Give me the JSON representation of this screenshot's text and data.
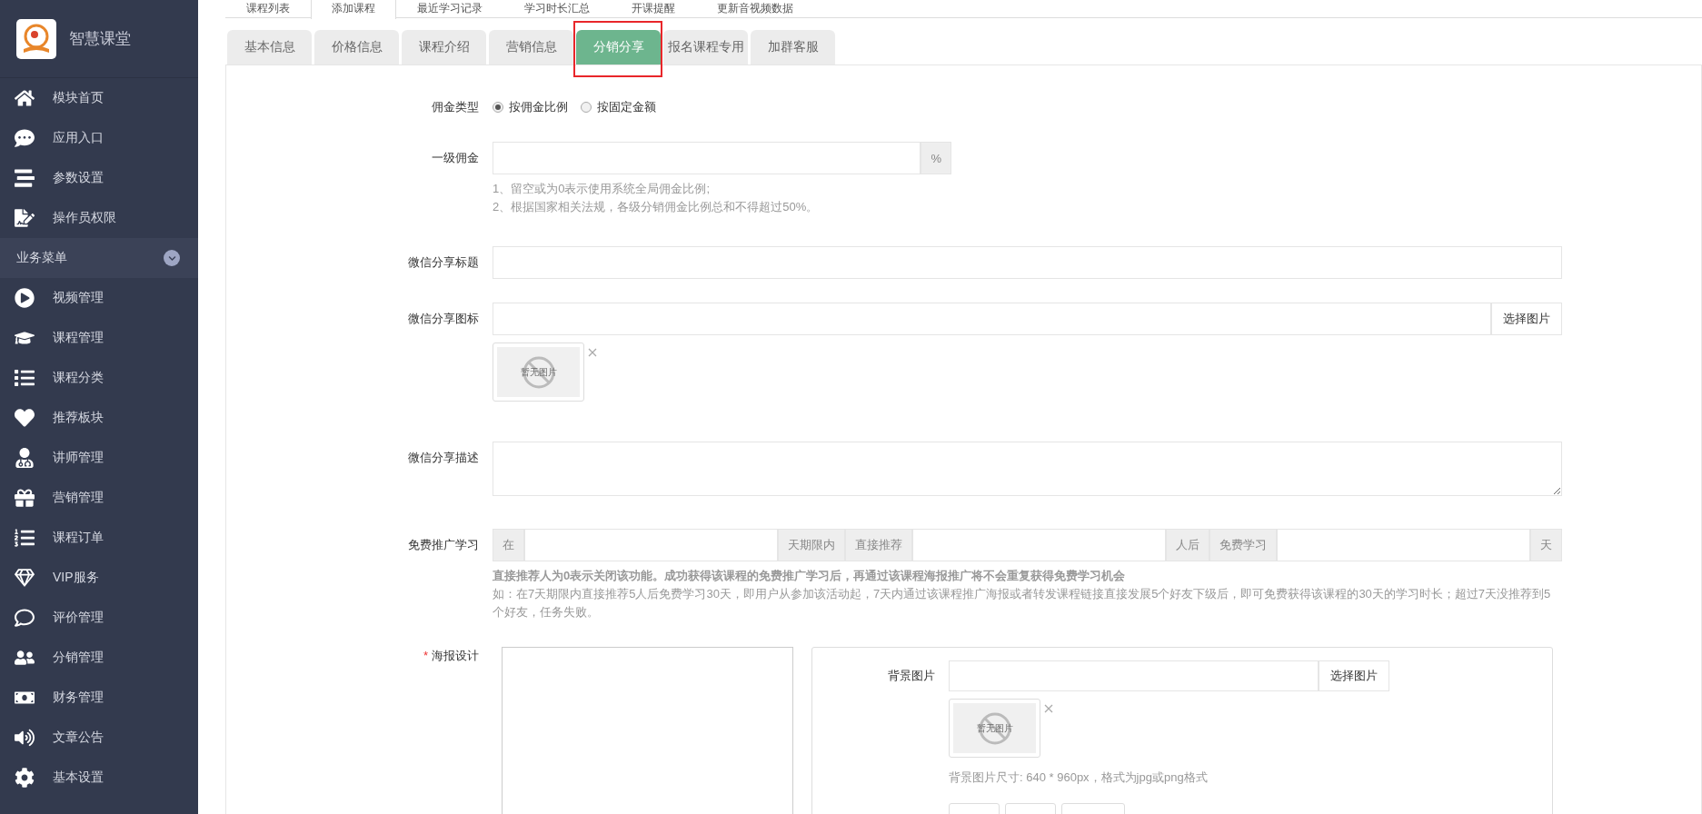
{
  "brand": {
    "name": "智慧课堂"
  },
  "top_tabs": [
    {
      "label": "课程列表",
      "selected": false
    },
    {
      "label": "添加课程",
      "selected": true
    },
    {
      "label": "最近学习记录",
      "selected": false
    },
    {
      "label": "学习时长汇总",
      "selected": false
    },
    {
      "label": "开课提醒",
      "selected": false
    },
    {
      "label": "更新音视频数据",
      "selected": false
    }
  ],
  "sidebar": {
    "items_top": [
      {
        "label": "模块首页"
      },
      {
        "label": "应用入口"
      },
      {
        "label": "参数设置"
      },
      {
        "label": "操作员权限"
      }
    ],
    "section": {
      "label": "业务菜单",
      "expanded": true
    },
    "items": [
      {
        "label": "视频管理"
      },
      {
        "label": "课程管理"
      },
      {
        "label": "课程分类"
      },
      {
        "label": "推荐板块"
      },
      {
        "label": "讲师管理"
      },
      {
        "label": "营销管理"
      },
      {
        "label": "课程订单"
      },
      {
        "label": "VIP服务"
      },
      {
        "label": "评价管理"
      },
      {
        "label": "分销管理"
      },
      {
        "label": "财务管理"
      },
      {
        "label": "文章公告"
      },
      {
        "label": "基本设置"
      }
    ]
  },
  "sub_tabs": [
    {
      "label": "基本信息",
      "selected": false
    },
    {
      "label": "价格信息",
      "selected": false
    },
    {
      "label": "课程介绍",
      "selected": false
    },
    {
      "label": "营销信息",
      "selected": false
    },
    {
      "label": "分销分享",
      "selected": true,
      "highlighted": true
    },
    {
      "label": "报名课程专用",
      "selected": false
    },
    {
      "label": "加群客服",
      "selected": false
    }
  ],
  "form": {
    "commission_type": {
      "label": "佣金类型",
      "options": [
        {
          "label": "按佣金比例",
          "selected": true
        },
        {
          "label": "按固定金额",
          "selected": false
        }
      ]
    },
    "level1": {
      "label": "一级佣金",
      "addon": "%",
      "hints": [
        "1、留空或为0表示使用系统全局佣金比例;",
        "2、根据国家相关法规，各级分销佣金比例总和不得超过50%。"
      ]
    },
    "share_title": {
      "label": "微信分享标题"
    },
    "share_icon": {
      "label": "微信分享图标",
      "button": "选择图片",
      "image_text": "暂无图片"
    },
    "share_desc": {
      "label": "微信分享描述"
    },
    "free_promo": {
      "label": "免费推广学习",
      "segments": [
        {
          "kind": "addon",
          "text": "在"
        },
        {
          "kind": "input"
        },
        {
          "kind": "addon",
          "text": "天期限内"
        },
        {
          "kind": "addon",
          "text": "直接推荐"
        },
        {
          "kind": "input"
        },
        {
          "kind": "addon",
          "text": "人后"
        },
        {
          "kind": "addon",
          "text": "免费学习"
        },
        {
          "kind": "input"
        },
        {
          "kind": "addon",
          "text": "天"
        }
      ],
      "note": "直接推荐人为0表示关闭该功能。成功获得该课程的免费推广学习后，再通过该课程海报推广将不会重复获得免费学习机会",
      "example": "如：在7天期限内直接推荐5人后免费学习30天，即用户从参加该活动起，7天内通过该课程推广海报或者转发课程链接直接发展5个好友下级后，即可免费获得该课程的30天的学习时长；超过7天没推荐到5个好友，任务失败。"
    },
    "poster": {
      "label": "海报设计",
      "required_mark": "*",
      "bg_label": "背景图片",
      "button": "选择图片",
      "image_text": "暂无图片",
      "hint": "背景图片尺寸: 640 * 960px，格式为jpg或png格式"
    }
  }
}
